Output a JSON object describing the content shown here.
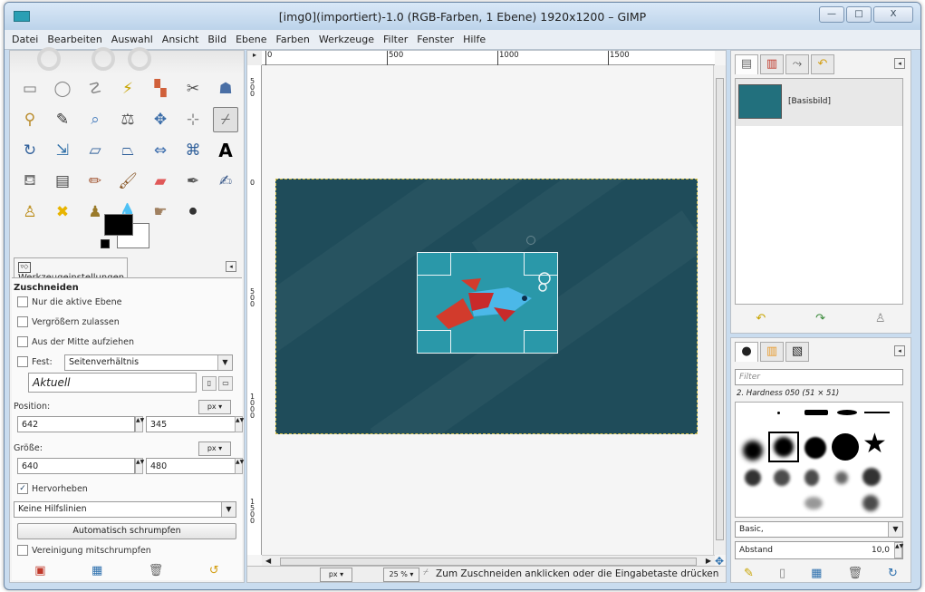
{
  "window": {
    "title": "[img0](importiert)-1.0 (RGB-Farben, 1 Ebene) 1920x1200 – GIMP",
    "minimize": "—",
    "maximize": "□",
    "close": "X"
  },
  "menu": [
    "Datei",
    "Bearbeiten",
    "Auswahl",
    "Ansicht",
    "Bild",
    "Ebene",
    "Farben",
    "Werkzeuge",
    "Filter",
    "Fenster",
    "Hilfe"
  ],
  "tool_options": {
    "tab_label": "Werkzeugeinstellungen",
    "section_title": "Zuschneiden",
    "only_active_layer": "Nur die aktive Ebene",
    "allow_growing": "Vergrößern zulassen",
    "expand_from_center": "Aus der Mitte aufziehen",
    "fixed_label": "Fest:",
    "fixed_value": "Seitenverhältnis",
    "current_value": "Aktuell",
    "position_label": "Position:",
    "position_unit": "px",
    "position_x": "642",
    "position_y": "345",
    "size_label": "Größe:",
    "size_unit": "px",
    "size_w": "640",
    "size_h": "480",
    "highlight": "Hervorheben",
    "guides_value": "Keine Hilfslinien",
    "auto_shrink": "Automatisch schrumpfen",
    "shrink_merged": "Vereinigung mitschrumpfen"
  },
  "ruler": {
    "top_ticks": [
      "0",
      "500",
      "1000",
      "1500"
    ],
    "left_ticks": [
      "500",
      "0",
      "500",
      "1000",
      "1500"
    ]
  },
  "status_bar": {
    "unit": "px",
    "zoom": "25 %",
    "message": "Zum Zuschneiden anklicken oder die Eingabetaste drücken"
  },
  "layers": {
    "layer_name": "[Basisbild]"
  },
  "brushes": {
    "filter_placeholder": "Filter",
    "selected_brush": "2. Hardness 050 (51 × 51)",
    "preset": "Basic,",
    "spacing_label": "Abstand",
    "spacing_value": "10,0"
  },
  "colors": {
    "image_bg": "#1f4c5a",
    "crop_fill": "#2a98a9",
    "titlebar": "#c9dcef"
  }
}
